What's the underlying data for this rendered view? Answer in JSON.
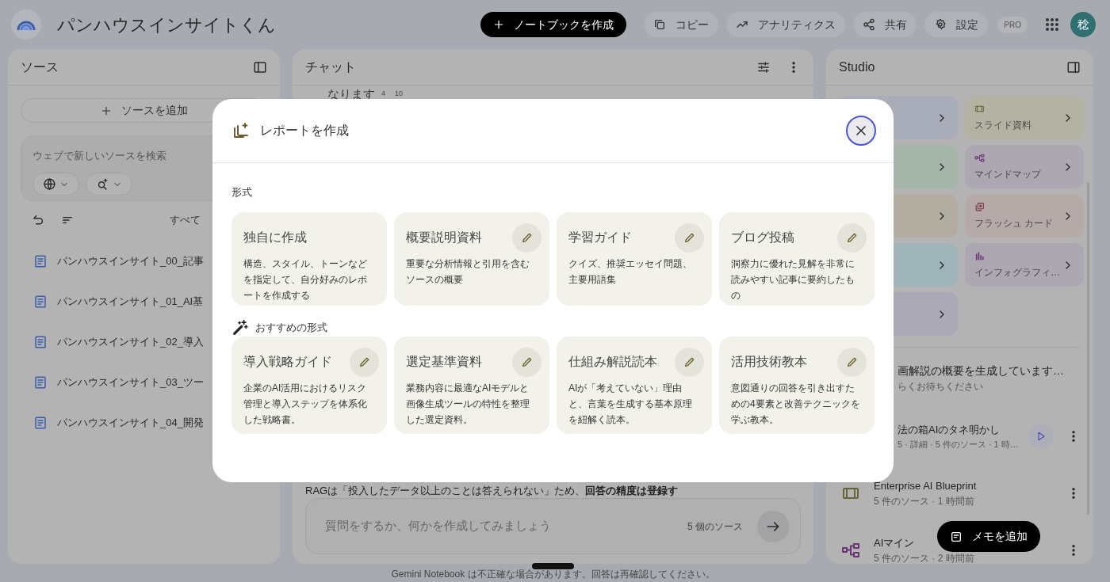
{
  "app": {
    "title": "パンハウスインサイトくん"
  },
  "toolbar": {
    "create_button": "ノートブックを作成",
    "buttons": [
      {
        "kind": "copy",
        "label": "コピー"
      },
      {
        "kind": "analytics",
        "label": "アナリティクス"
      },
      {
        "kind": "share",
        "label": "共有"
      },
      {
        "kind": "settings",
        "label": "設定"
      }
    ],
    "badge": "PRO",
    "avatar": "稔"
  },
  "sources": {
    "title": "ソース",
    "add_button": "ソースを追加",
    "search": {
      "placeholder": "ウェブで新しいソースを検索"
    },
    "select_all": "すべて",
    "items": [
      {
        "name": "パンハウスインサイト_00_記事"
      },
      {
        "name": "パンハウスインサイト_01_AI基"
      },
      {
        "name": "パンハウスインサイト_02_導入"
      },
      {
        "name": "パンハウスインサイト_03_ツー"
      },
      {
        "name": "パンハウスインサイト_04_開発"
      }
    ]
  },
  "chat": {
    "title": "チャット",
    "message_top": {
      "text": "なります",
      "citations": [
        "4",
        "10"
      ]
    },
    "message_bottom": "RAGは「投入したデータ以上のことは答えられない」ため、**回答の精度は登録す**",
    "input": {
      "placeholder": "質問をするか、何かを作成してみましょう",
      "source_count": "5 個のソース"
    },
    "disclaimer": "Gemini Notebook は不正確な場合があります。回答は再確認してください。"
  },
  "studio": {
    "title": "Studio",
    "tiles": [
      {
        "color": "#a9adb9"
      },
      {
        "kind": "slides",
        "label": "スライド資料",
        "color": "#b4b3a3"
      },
      {
        "color": "#a5b5a9"
      },
      {
        "kind": "mindmap",
        "label": "マインドマップ",
        "color": "#ada7b1"
      },
      {
        "color": "#b1aea1"
      },
      {
        "kind": "flashcards",
        "label": "フラッシュ カード",
        "color": "#b6aaa9"
      },
      {
        "color": "#9fb4b8"
      },
      {
        "kind": "infographic",
        "label": "インフォグラフィ…",
        "color": "#ada7b1"
      },
      {
        "color": "#aaa9b5"
      }
    ],
    "items": [
      {
        "kind": "generating",
        "title": "画解説の概要を生成しています…",
        "subtitle": "らくお待ちください"
      },
      {
        "kind": "audio",
        "title": "法の箱AIのタネ明かし",
        "subtitle": "5 · 詳細 · 5 件のソース · 1 時…"
      },
      {
        "kind": "slides",
        "title": "Enterprise AI Blueprint",
        "subtitle": "5 件のソース · 1 時間前"
      },
      {
        "kind": "mindmap",
        "title": "AIマイン",
        "subtitle": "5 件のソース · 2 時間前"
      }
    ],
    "fab": "メモを追加"
  },
  "dialog": {
    "title": "レポートを作成",
    "sections": [
      {
        "heading": "形式",
        "kind": "plain",
        "cards": [
          {
            "title": "独自に作成",
            "description": "構造、スタイル、トーンなどを指定して、自分好みのレポートを作成する",
            "editable": false
          },
          {
            "title": "概要説明資料",
            "description": "重要な分析情報と引用を含むソースの概要",
            "editable": true
          },
          {
            "title": "学習ガイド",
            "description": "クイズ、推奨エッセイ問題、主要用語集",
            "editable": true
          },
          {
            "title": "ブログ投稿",
            "description": "洞察力に優れた見解を非常に読みやすい記事に要約したもの",
            "editable": true
          }
        ]
      },
      {
        "heading": "おすすめの形式",
        "kind": "suggested",
        "cards": [
          {
            "title": "導入戦略ガイド",
            "description": "企業のAI活用におけるリスク管理と導入ステップを体系化した戦略書。",
            "editable": true
          },
          {
            "title": "選定基準資料",
            "description": "業務内容に最適なAIモデルと画像生成ツールの特性を整理した選定資料。",
            "editable": true
          },
          {
            "title": "仕組み解説読本",
            "description": "AIが「考えていない」理由と、言葉を生成する基本原理を紐解く読本。",
            "editable": true
          },
          {
            "title": "活用技術教本",
            "description": "意図通りの回答を引き出すための4要素と改善テクニックを学ぶ教本。",
            "editable": true
          }
        ]
      }
    ]
  }
}
